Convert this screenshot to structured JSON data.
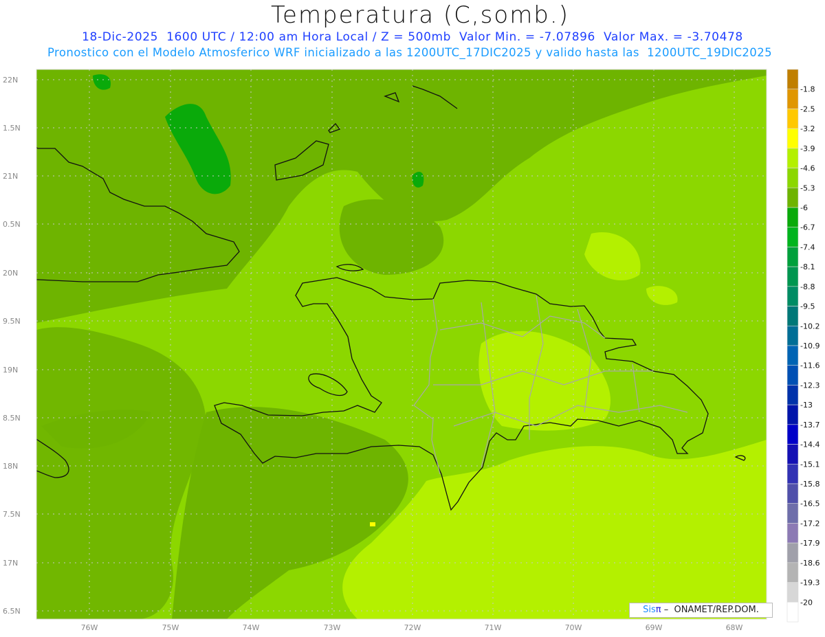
{
  "title": "Temperatura (C,somb.)",
  "subtitle_line1": "18-Dic-2025  1600 UTC / 12:00 am Hora Local / Z = 500mb  Valor Min. = -7.07896  Valor Max. = -3.70478",
  "subtitle_line2": "Pronostico con el Modelo Atmosferico WRF inicializado a las 1200UTC_17DIC2025 y valido hasta las  1200UTC_19DIC2025",
  "lat_labels": [
    "22N",
    "1.5N",
    "21N",
    "0.5N",
    "20N",
    "9.5N",
    "19N",
    "8.5N",
    "18N",
    "7.5N",
    "17N",
    "6.5N"
  ],
  "lon_labels": [
    "76W",
    "75W",
    "74W",
    "73W",
    "72W",
    "71W",
    "70W",
    "69W",
    "68W"
  ],
  "colorbar": {
    "labels": [
      "-1.8",
      "-2.5",
      "-3.2",
      "-3.9",
      "-4.6",
      "-5.3",
      "-6",
      "-6.7",
      "-7.4",
      "-8.1",
      "-8.8",
      "-9.5",
      "-10.2",
      "-10.9",
      "-11.6",
      "-12.3",
      "-13",
      "-13.7",
      "-14.4",
      "-15.1",
      "-15.8",
      "-16.5",
      "-17.2",
      "-17.9",
      "-18.6",
      "-19.3",
      "-20"
    ],
    "colors": [
      "#c07f00",
      "#e09600",
      "#ffc800",
      "#ffff00",
      "#b4f000",
      "#8cd700",
      "#6eb400",
      "#0aaa0a",
      "#00b41e",
      "#00a03c",
      "#009650",
      "#008c64",
      "#007878",
      "#006e96",
      "#0064b4",
      "#0050b4",
      "#0032aa",
      "#0014aa",
      "#0000c8",
      "#1410b4",
      "#3232b4",
      "#5050aa",
      "#6e6eaa",
      "#8c7ab4",
      "#a0a0aa",
      "#b4b4b4",
      "#d7d7d7",
      "#ffffff"
    ]
  },
  "credit": {
    "sis": "Sis",
    "pi": "π",
    "text": " –  ONAMET/REP.DOM."
  }
}
